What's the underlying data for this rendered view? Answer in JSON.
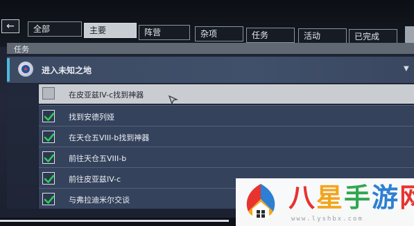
{
  "header": {
    "back_icon": "arrow-left-icon",
    "back_glyph": "←",
    "tabs": [
      {
        "label": "全部",
        "active": false
      },
      {
        "label": "主要",
        "active": true
      },
      {
        "label": "阵营",
        "active": false
      },
      {
        "label": "杂项",
        "active": false
      },
      {
        "label": "任务",
        "active": false
      },
      {
        "label": "活动",
        "active": false
      },
      {
        "label": "已完成",
        "active": false
      }
    ]
  },
  "section": {
    "title": "任务"
  },
  "mission": {
    "title": "进入未知之地",
    "emblem_icon": "faction-emblem-icon",
    "caret": "▼",
    "accent_color": "#4fb7e0"
  },
  "tasks": [
    {
      "label": "在皮亚兹IV-c找到神器",
      "completed": false
    },
    {
      "label": "找到安德列娅",
      "completed": true
    },
    {
      "label": "在天仓五VIII-b找到神器",
      "completed": true
    },
    {
      "label": "前往天仓五VIII-b",
      "completed": true
    },
    {
      "label": "前往皮亚兹IV-c",
      "completed": true
    },
    {
      "label": "与弗拉迪米尔交谈",
      "completed": true
    }
  ],
  "colors": {
    "check_green": "#2ecc5a"
  },
  "watermark": {
    "text_1": "八",
    "text_2": "星",
    "text_3": "手",
    "text_4": "游",
    "text_5": "网",
    "url": "www.lyshbx.com"
  }
}
